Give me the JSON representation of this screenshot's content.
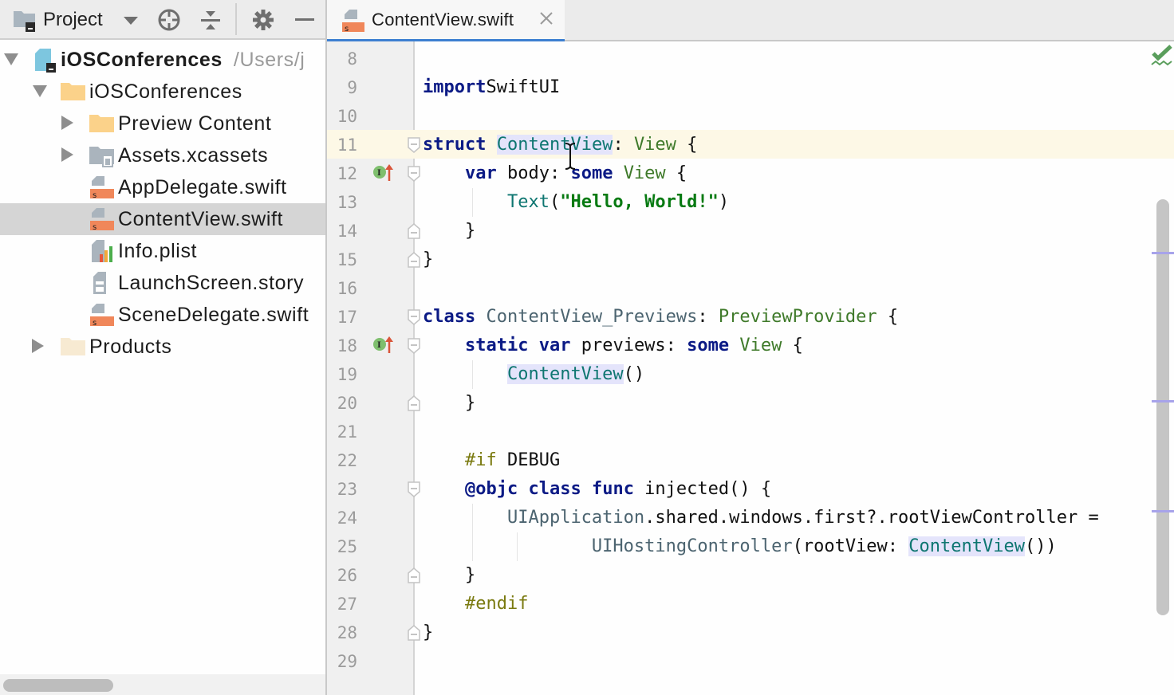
{
  "project_panel": {
    "title": "Project",
    "toolbar_icons": [
      "project-folder-icon",
      "dropdown-caret-icon",
      "locate-target-icon",
      "collapse-all-icon",
      "gear-icon",
      "hide-minus-icon"
    ],
    "tree": [
      {
        "label": "iOSConferences",
        "path": "/Users/j",
        "icon": "project-module-icon",
        "expanded": true,
        "bold": true,
        "level": 0
      },
      {
        "label": "iOSConferences",
        "icon": "folder-icon",
        "expanded": true,
        "level": 1
      },
      {
        "label": "Preview Content",
        "icon": "folder-icon",
        "expanded": false,
        "level": 2
      },
      {
        "label": "Assets.xcassets",
        "icon": "assets-folder-icon",
        "expanded": false,
        "level": 2
      },
      {
        "label": "AppDelegate.swift",
        "icon": "swift-file-icon",
        "level": 2
      },
      {
        "label": "ContentView.swift",
        "icon": "swift-file-icon",
        "level": 2,
        "selected": true
      },
      {
        "label": "Info.plist",
        "icon": "plist-file-icon",
        "level": 2
      },
      {
        "label": "LaunchScreen.story",
        "icon": "storyboard-file-icon",
        "level": 2
      },
      {
        "label": "SceneDelegate.swift",
        "icon": "swift-file-icon",
        "level": 2
      },
      {
        "label": "Products",
        "icon": "products-folder-icon",
        "expanded": false,
        "level": 1
      }
    ]
  },
  "editor": {
    "tabs": [
      {
        "label": "ContentView.swift",
        "active": true,
        "closable": true
      }
    ],
    "caret_line": 11,
    "inspection_status": "ok",
    "lines": [
      {
        "num": "8",
        "tokens": []
      },
      {
        "num": "9",
        "tokens": [
          [
            "kw",
            "import"
          ],
          [
            "",
            "SwiftUI"
          ]
        ]
      },
      {
        "num": "10",
        "tokens": []
      },
      {
        "num": "11",
        "tokens": [
          [
            "kw",
            "struct"
          ],
          [
            "",
            " "
          ],
          [
            "ident hl",
            "ContentView"
          ],
          [
            "",
            ": "
          ],
          [
            "type",
            "View"
          ],
          [
            "",
            " {"
          ]
        ]
      },
      {
        "num": "12",
        "tokens": [
          [
            "",
            "    "
          ],
          [
            "kw",
            "var"
          ],
          [
            "",
            " body: "
          ],
          [
            "kw",
            "some"
          ],
          [
            "",
            " "
          ],
          [
            "type",
            "View"
          ],
          [
            "",
            " {"
          ]
        ]
      },
      {
        "num": "13",
        "tokens": [
          [
            "",
            "        "
          ],
          [
            "ident",
            "Text"
          ],
          [
            "",
            "("
          ],
          [
            "str",
            "\"Hello, World!\""
          ],
          [
            "",
            ")"
          ]
        ]
      },
      {
        "num": "14",
        "tokens": [
          [
            "",
            "    }"
          ]
        ]
      },
      {
        "num": "15",
        "tokens": [
          [
            "",
            "}"
          ]
        ]
      },
      {
        "num": "16",
        "tokens": []
      },
      {
        "num": "17",
        "tokens": [
          [
            "kw",
            "class"
          ],
          [
            "",
            " "
          ],
          [
            "cls",
            "ContentView_Previews"
          ],
          [
            "",
            ": "
          ],
          [
            "type",
            "PreviewProvider"
          ],
          [
            "",
            " {"
          ]
        ]
      },
      {
        "num": "18",
        "tokens": [
          [
            "",
            "    "
          ],
          [
            "kw",
            "static"
          ],
          [
            "",
            " "
          ],
          [
            "kw",
            "var"
          ],
          [
            "",
            " previews: "
          ],
          [
            "kw",
            "some"
          ],
          [
            "",
            " "
          ],
          [
            "type",
            "View"
          ],
          [
            "",
            " {"
          ]
        ]
      },
      {
        "num": "19",
        "tokens": [
          [
            "",
            "        "
          ],
          [
            "ident hl",
            "ContentView"
          ],
          [
            "",
            "()"
          ]
        ]
      },
      {
        "num": "20",
        "tokens": [
          [
            "",
            "    }"
          ]
        ]
      },
      {
        "num": "21",
        "tokens": []
      },
      {
        "num": "22",
        "tokens": [
          [
            "",
            "    "
          ],
          [
            "pp",
            "#if"
          ],
          [
            "",
            " DEBUG"
          ]
        ]
      },
      {
        "num": "23",
        "tokens": [
          [
            "",
            "    "
          ],
          [
            "kw",
            "@objc"
          ],
          [
            "",
            " "
          ],
          [
            "kw",
            "class"
          ],
          [
            "",
            " "
          ],
          [
            "kw",
            "func"
          ],
          [
            "",
            " injected() {"
          ]
        ]
      },
      {
        "num": "24",
        "tokens": [
          [
            "",
            "        "
          ],
          [
            "cls",
            "UIApplication"
          ],
          [
            "",
            ".shared.windows.first?.rootViewController ="
          ]
        ]
      },
      {
        "num": "25",
        "tokens": [
          [
            "",
            "                "
          ],
          [
            "cls",
            "UIHostingController"
          ],
          [
            "",
            "(rootView: "
          ],
          [
            "ident hl",
            "ContentView"
          ],
          [
            "",
            "())"
          ]
        ]
      },
      {
        "num": "26",
        "tokens": [
          [
            "",
            "    }"
          ]
        ]
      },
      {
        "num": "27",
        "tokens": [
          [
            "",
            "    "
          ],
          [
            "pp",
            "#endif"
          ]
        ]
      },
      {
        "num": "28",
        "tokens": [
          [
            "",
            "}"
          ]
        ]
      },
      {
        "num": "29",
        "tokens": []
      }
    ],
    "gutter_markers": [
      {
        "line": 12,
        "icon": "implements-up-arrow-icon"
      },
      {
        "line": 18,
        "icon": "implements-up-arrow-icon"
      }
    ]
  },
  "colors": {
    "keyword": "#0b1a85",
    "type": "#3f7a2a",
    "identifier": "#0e7671",
    "string": "#077a12",
    "preprocessor": "#7a7a10",
    "tab_underline": "#3d7fd1",
    "caret_line": "#fdf8e6",
    "swift_icon": "#f0875a"
  }
}
